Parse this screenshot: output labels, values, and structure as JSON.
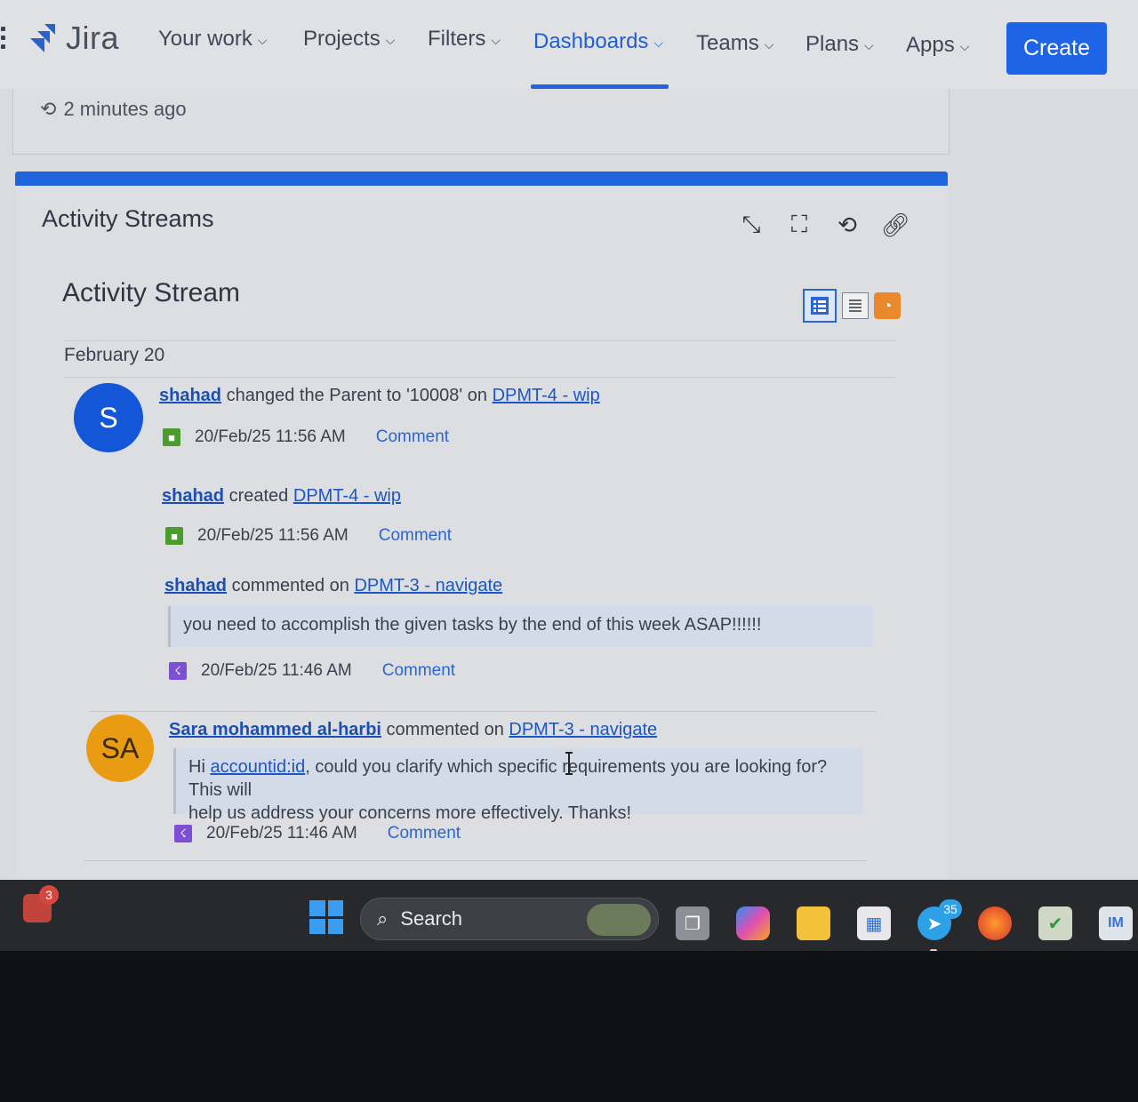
{
  "nav": {
    "brand": "Jira",
    "items": [
      {
        "label": "Your work",
        "active": false
      },
      {
        "label": "Projects",
        "active": false
      },
      {
        "label": "Filters",
        "active": false
      },
      {
        "label": "Dashboards",
        "active": true
      },
      {
        "label": "Teams",
        "active": false
      },
      {
        "label": "Plans",
        "active": false
      },
      {
        "label": "Apps",
        "active": false
      }
    ],
    "create_label": "Create"
  },
  "refresh": {
    "text": "2 minutes ago"
  },
  "gadget": {
    "title": "Activity Streams",
    "tools": [
      "minimize-icon",
      "fullscreen-icon",
      "refresh-icon",
      "link-icon"
    ]
  },
  "stream": {
    "title": "Activity Stream",
    "date_heading": "February 20",
    "entries": [
      {
        "avatar": "S",
        "user": "shahad",
        "action": "changed the Parent to '10008' on",
        "issue": "DPMT-4 - wip",
        "time": "20/Feb/25 11:56 AM",
        "comment": "Comment",
        "icon": "story-icon"
      },
      {
        "user": "shahad",
        "action": "created",
        "issue": "DPMT-4 - wip",
        "time": "20/Feb/25 11:56 AM",
        "comment": "Comment",
        "icon": "story-icon"
      },
      {
        "user": "shahad",
        "action": "commented on",
        "issue": "DPMT-3 - navigate",
        "quote": "you need to accomplish the given tasks by the end of this week ASAP!!!!!!",
        "time": "20/Feb/25 11:46 AM",
        "comment": "Comment",
        "icon": "subtask-icon"
      },
      {
        "avatar": "SA",
        "user": "Sara mohammed al-harbi",
        "action": "commented on",
        "issue": "DPMT-3 - navigate",
        "quote_prefix": "Hi",
        "quote_mention": "accountid:id",
        "quote_line1": ", could you clarify which specific requirements you are looking for? This will",
        "quote_line2": "help us address your concerns more effectively. Thanks!",
        "time": "20/Feb/25 11:46 AM",
        "comment": "Comment",
        "icon": "subtask-icon"
      }
    ]
  },
  "taskbar": {
    "notification_count": "3",
    "search_label": "Search",
    "telegram_badge": "35",
    "apps": [
      "task-view-icon",
      "copilot-icon",
      "file-explorer-icon",
      "store-icon",
      "telegram-icon",
      "firefox-icon",
      "check-app-icon",
      "im-app-icon"
    ]
  },
  "colors": {
    "accent": "#1e64e6",
    "gadget_bar": "#1f63dd",
    "avatar_s": "#1357d8",
    "avatar_sa": "#e99b12",
    "rss": "#e9892b"
  }
}
